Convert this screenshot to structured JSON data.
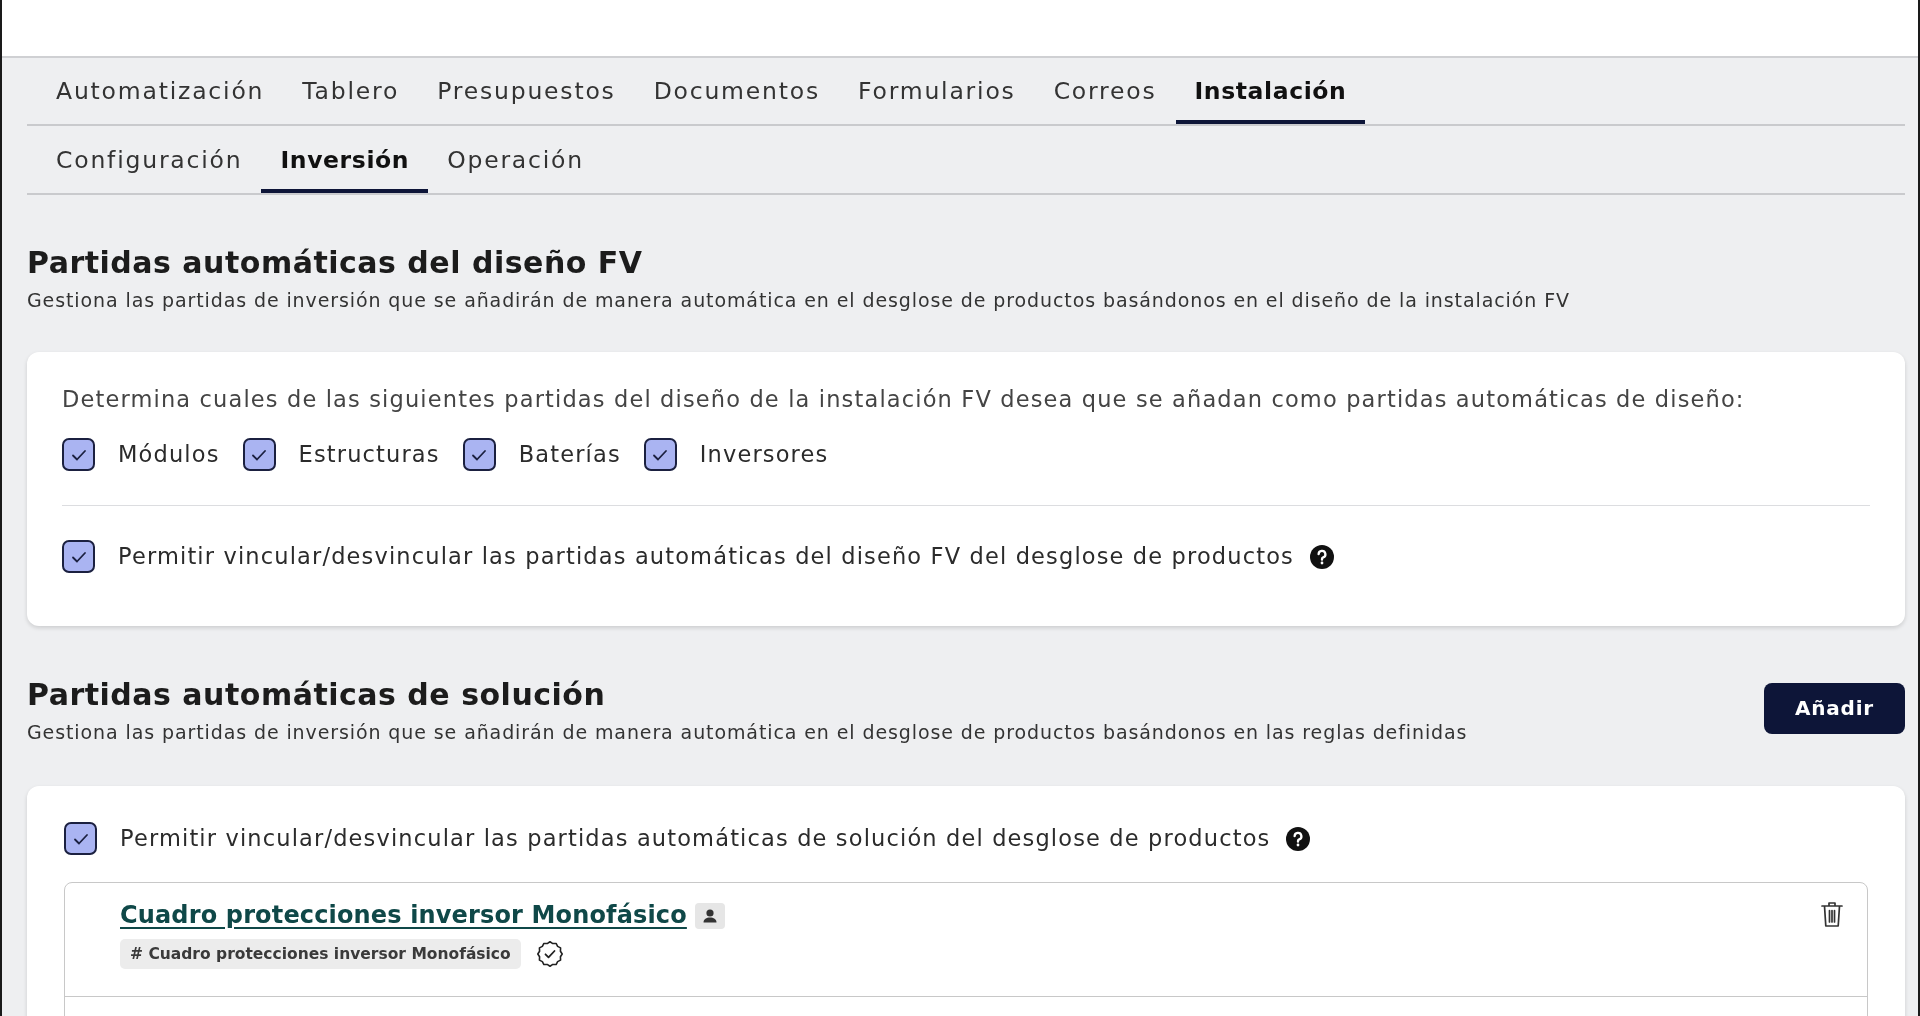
{
  "main_tabs": [
    {
      "label": "Automatización",
      "selected": false
    },
    {
      "label": "Tablero",
      "selected": false
    },
    {
      "label": "Presupuestos",
      "selected": false
    },
    {
      "label": "Documentos",
      "selected": false
    },
    {
      "label": "Formularios",
      "selected": false
    },
    {
      "label": "Correos",
      "selected": false
    },
    {
      "label": "Instalación",
      "selected": true
    }
  ],
  "sub_tabs": [
    {
      "label": "Configuración",
      "selected": false
    },
    {
      "label": "Inversión",
      "selected": true
    },
    {
      "label": "Operación",
      "selected": false
    }
  ],
  "sections": [
    {
      "title": "Partidas automáticas del diseño FV",
      "description": "Gestiona las partidas de inversión que se añadirán de manera automática en el desglose de productos basándonos en el diseño de la instalación FV",
      "card": {
        "prompt": "Determina cuales de las siguientes partidas del diseño de la instalación FV desea que se añadan como partidas automáticas de diseño:",
        "options": [
          {
            "label": "Módulos",
            "checked": true
          },
          {
            "label": "Estructuras",
            "checked": true
          },
          {
            "label": "Baterías",
            "checked": true
          },
          {
            "label": "Inversores",
            "checked": true
          }
        ],
        "link_toggle": {
          "label": "Permitir vincular/desvincular las partidas automáticas del diseño FV del desglose de productos",
          "checked": true,
          "help": true
        }
      }
    },
    {
      "title": "Partidas automáticas de solución",
      "description": "Gestiona las partidas de inversión que se añadirán de manera automática en el desglose de productos basándonos en las reglas definidas",
      "action_button": "Añadir",
      "card": {
        "link_toggle": {
          "label": "Permitir vincular/desvincular las partidas automáticas de solución del desglose de productos",
          "checked": true,
          "help": true
        },
        "items": [
          {
            "title": "Cuadro protecciones inversor Monofásico",
            "tag": "# Cuadro protecciones inversor Monofásico",
            "verified": true
          }
        ]
      }
    }
  ]
}
